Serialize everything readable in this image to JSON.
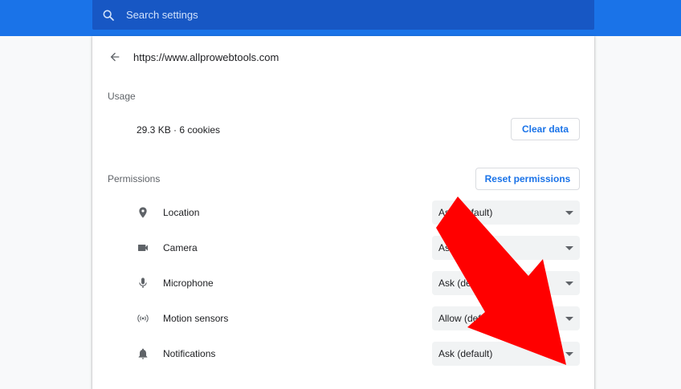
{
  "search": {
    "placeholder": "Search settings",
    "icon": "search-icon"
  },
  "site": {
    "url": "https://www.allprowebtools.com",
    "back_icon": "arrow-back-icon"
  },
  "usage": {
    "label": "Usage",
    "summary": "29.3 KB · 6 cookies",
    "clear_button": "Clear data"
  },
  "permissions": {
    "label": "Permissions",
    "reset_button": "Reset permissions",
    "items": [
      {
        "label": "Location",
        "value": "Ask (default)",
        "icon": "location-pin-icon"
      },
      {
        "label": "Camera",
        "value": "Ask (default)",
        "icon": "camera-icon"
      },
      {
        "label": "Microphone",
        "value": "Ask (default)",
        "icon": "microphone-icon"
      },
      {
        "label": "Motion sensors",
        "value": "Allow (default)",
        "icon": "motion-sensors-icon"
      },
      {
        "label": "Notifications",
        "value": "Ask (default)",
        "icon": "bell-icon"
      }
    ]
  },
  "colors": {
    "topbar": "#1a73e8",
    "searchbox": "#1757c4",
    "accent": "#1a73e8",
    "annotation_arrow": "#ff0000"
  }
}
